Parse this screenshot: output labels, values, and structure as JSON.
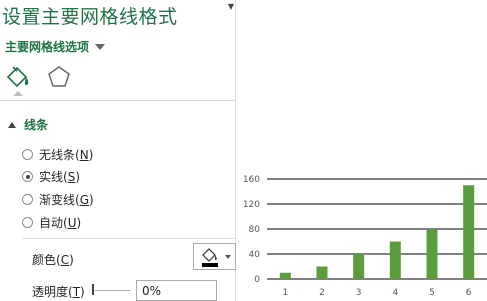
{
  "pane": {
    "title": "设置主要网格线格式",
    "options_label": "主要网格线选项",
    "section_title": "线条",
    "radios": [
      {
        "label": "无线条(",
        "key": "N",
        "end": ")",
        "selected": false
      },
      {
        "label": "实线(",
        "key": "S",
        "end": ")",
        "selected": true
      },
      {
        "label": "渐变线(",
        "key": "G",
        "end": ")",
        "selected": false
      },
      {
        "label": "自动(",
        "key": "U",
        "end": ")",
        "selected": false
      }
    ],
    "color_label": "颜色(",
    "color_key": "C",
    "color_end": ")",
    "transparency_label": "透明度(",
    "transparency_key": "T",
    "transparency_end": ")",
    "transparency_value": "0%",
    "line_color": "#000000",
    "icons": {
      "fill_tab": "paint-bucket-icon",
      "effects_tab": "pentagon-icon",
      "color_button": "outline-color-icon"
    },
    "accent_color": "#217346"
  },
  "chart_data": {
    "type": "bar",
    "categories": [
      "1",
      "2",
      "3",
      "4",
      "5",
      "6"
    ],
    "values": [
      10,
      20,
      40,
      60,
      80,
      150
    ],
    "yticks": [
      0,
      40,
      80,
      120,
      160
    ],
    "ylim": [
      0,
      160
    ],
    "bar_color": "#5b9c3c",
    "gridline_color": "#000000"
  }
}
